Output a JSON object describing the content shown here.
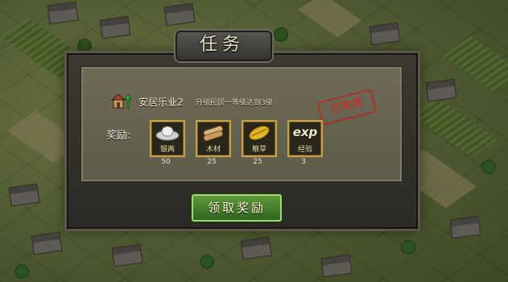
{
  "dialog": {
    "title": "任务",
    "quest": {
      "name": "安居乐业2",
      "description": "升级民居一等级达到3级",
      "status_stamp": "已完成"
    },
    "reward_label": "奖励:",
    "rewards": [
      {
        "name": "银两",
        "quantity": "50",
        "icon": "silver-ingot-icon"
      },
      {
        "name": "木材",
        "quantity": "25",
        "icon": "wood-icon"
      },
      {
        "name": "粮草",
        "quantity": "25",
        "icon": "grain-icon"
      },
      {
        "name": "经验",
        "quantity": "3",
        "icon": "exp-icon",
        "icon_text": "exp"
      }
    ],
    "claim_button": "领取奖励"
  },
  "colors": {
    "stamp": "#b6362c",
    "button": "#4f8a32",
    "slot_border": "#c7a24a"
  }
}
